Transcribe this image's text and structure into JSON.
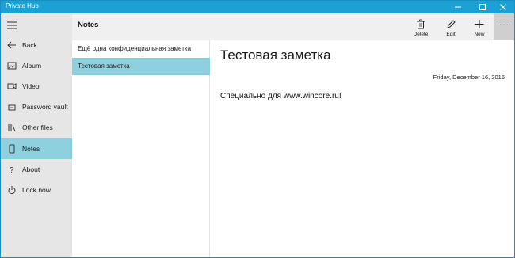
{
  "window": {
    "title": "Private Hub"
  },
  "sidebar": {
    "menu_icon": "hamburger-icon",
    "items": [
      {
        "label": "Back",
        "icon": "back-arrow-icon"
      },
      {
        "label": "Album",
        "icon": "image-icon"
      },
      {
        "label": "Video",
        "icon": "video-icon"
      },
      {
        "label": "Password vault",
        "icon": "key-icon"
      },
      {
        "label": "Other files",
        "icon": "library-icon"
      },
      {
        "label": "Notes",
        "icon": "note-icon",
        "selected": true
      },
      {
        "label": "About",
        "icon": "question-icon"
      },
      {
        "label": "Lock now",
        "icon": "power-icon"
      }
    ]
  },
  "toolbar": {
    "title": "Notes",
    "delete_label": "Delete",
    "edit_label": "Edit",
    "new_label": "New",
    "more_label": "···"
  },
  "notes_list": {
    "items": [
      {
        "title": "Ещё одна конфиденциальная заметка",
        "selected": false
      },
      {
        "title": "Тестовая заметка",
        "selected": true
      }
    ]
  },
  "note": {
    "title": "Тестовая заметка",
    "date": "Friday, December 16, 2016",
    "body": "Специально для www.wincore.ru!"
  },
  "colors": {
    "titlebar": "#1ba1d4",
    "selection": "#8fd0de",
    "sidebar": "#e6e6e6"
  }
}
